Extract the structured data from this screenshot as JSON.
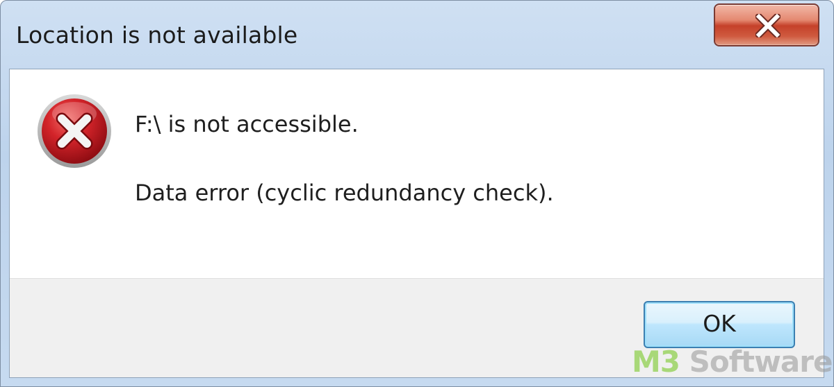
{
  "window": {
    "title": "Location is not available",
    "close_icon": "close-icon"
  },
  "message": {
    "icon": "error-icon",
    "line1": "F:\\ is not accessible.",
    "line2": "Data error (cyclic redundancy check)."
  },
  "buttons": {
    "ok_label": "OK"
  },
  "watermark": {
    "brand_prefix": "M3",
    "brand_suffix": "Software"
  },
  "colors": {
    "title_bar": "#c6daf0",
    "close_button": "#c5412a",
    "error_icon": "#c8141c",
    "ok_button_border": "#3c7fb1",
    "footer": "#f0f0f0"
  }
}
